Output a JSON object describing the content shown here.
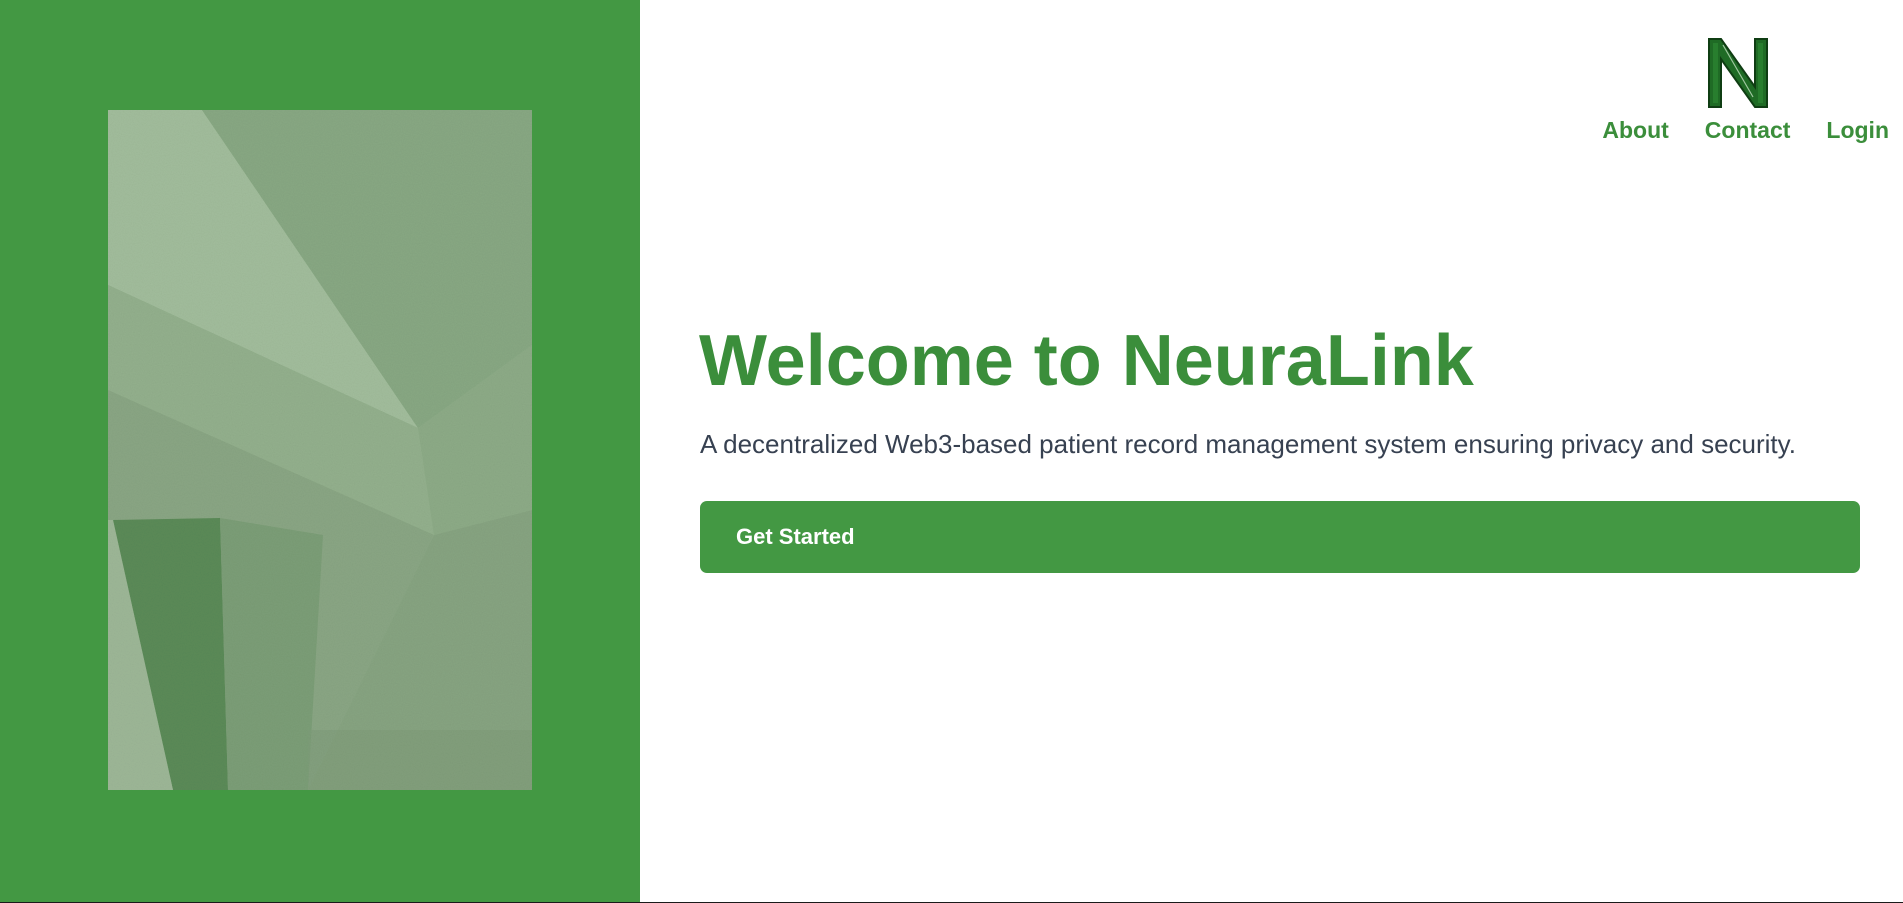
{
  "brand": {
    "logo_icon": "n-letter-logo-icon",
    "accent_color": "#439843",
    "text_accent_color": "#3b8e3b"
  },
  "nav": {
    "items": [
      {
        "label": "About"
      },
      {
        "label": "Contact"
      },
      {
        "label": "Login"
      }
    ]
  },
  "hero": {
    "title": "Welcome to NeuraLink",
    "subtitle": "A decentralized Web3-based patient record management system ensuring privacy and security.",
    "cta_label": "Get Started",
    "image_icon": "abstract-green-geometric-image"
  }
}
